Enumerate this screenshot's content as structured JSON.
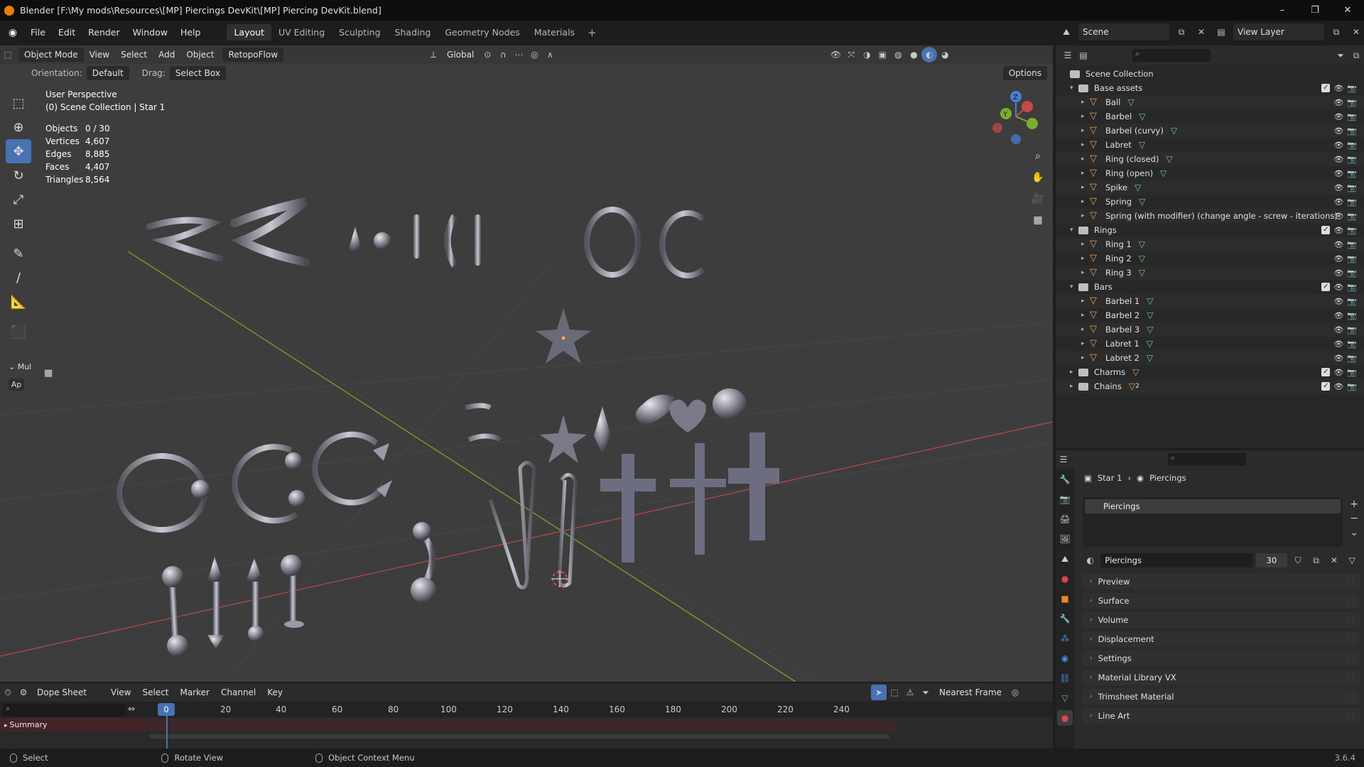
{
  "window": {
    "title": "Blender [F:\\My mods\\Resources\\[MP] Piercings DevKit\\[MP] Piercing DevKit.blend]",
    "buttons": [
      "–",
      "❐",
      "✕"
    ]
  },
  "menu": {
    "items": [
      "File",
      "Edit",
      "Render",
      "Window",
      "Help"
    ],
    "workspaces": [
      "Layout",
      "UV Editing",
      "Sculpting",
      "Shading",
      "Geometry Nodes",
      "Materials"
    ],
    "active_workspace": "Layout",
    "scene": "Scene",
    "view_layer": "View Layer"
  },
  "viewport": {
    "mode": "Object Mode",
    "menus": [
      "View",
      "Select",
      "Add",
      "Object"
    ],
    "addon": "RetopoFlow",
    "orientation_global": "Global",
    "orientation_label": "Orientation:",
    "orientation_value": "Default",
    "drag_label": "Drag:",
    "drag_value": "Select Box",
    "options": "Options",
    "info_line1": "User Perspective",
    "info_line2": "(0) Scene Collection | Star 1",
    "stats": [
      {
        "k": "Objects",
        "v": "0 / 30"
      },
      {
        "k": "Vertices",
        "v": "4,607"
      },
      {
        "k": "Edges",
        "v": "8,885"
      },
      {
        "k": "Faces",
        "v": "4,407"
      },
      {
        "k": "Triangles",
        "v": "8,564"
      }
    ],
    "panel_label": "Mul",
    "panel_btn": "Ap",
    "gizmo": {
      "x": "X",
      "y": "Y",
      "z": "Z"
    }
  },
  "timeline": {
    "editor": "Dope Sheet",
    "menus": [
      "View",
      "Select",
      "Marker",
      "Channel",
      "Key"
    ],
    "snap": "Nearest Frame",
    "current_frame": "0",
    "ticks": [
      "20",
      "40",
      "60",
      "80",
      "100",
      "120",
      "140",
      "160",
      "180",
      "200",
      "220",
      "240"
    ],
    "summary": "Summary"
  },
  "status": {
    "select": "Select",
    "rotate": "Rotate View",
    "context": "Object Context Menu",
    "version": "3.6.4"
  },
  "outliner": {
    "root": "Scene Collection",
    "rows": [
      {
        "type": "col",
        "depth": 1,
        "label": "Base assets",
        "mesh": false
      },
      {
        "type": "obj",
        "depth": 2,
        "label": "Ball",
        "mesh": true
      },
      {
        "type": "obj",
        "depth": 2,
        "label": "Barbel",
        "mesh": true
      },
      {
        "type": "obj",
        "depth": 2,
        "label": "Barbel (curvy)",
        "mesh": true
      },
      {
        "type": "obj",
        "depth": 2,
        "label": "Labret",
        "mesh": true
      },
      {
        "type": "obj",
        "depth": 2,
        "label": "Ring (closed)",
        "mesh": true
      },
      {
        "type": "obj",
        "depth": 2,
        "label": "Ring (open)",
        "mesh": true
      },
      {
        "type": "obj",
        "depth": 2,
        "label": "Spike",
        "mesh": true
      },
      {
        "type": "obj",
        "depth": 2,
        "label": "Spring",
        "mesh": true
      },
      {
        "type": "obj",
        "depth": 2,
        "label": "Spring (with modifier) (change angle - screw - iterations)",
        "mesh": false
      },
      {
        "type": "col",
        "depth": 1,
        "label": "Rings",
        "mesh": false
      },
      {
        "type": "obj",
        "depth": 2,
        "label": "Ring 1",
        "mesh": true
      },
      {
        "type": "obj",
        "depth": 2,
        "label": "Ring 2",
        "mesh": true
      },
      {
        "type": "obj",
        "depth": 2,
        "label": "Ring 3",
        "mesh": true
      },
      {
        "type": "col",
        "depth": 1,
        "label": "Bars",
        "mesh": false
      },
      {
        "type": "obj",
        "depth": 2,
        "label": "Barbel 1",
        "mesh": true
      },
      {
        "type": "obj",
        "depth": 2,
        "label": "Barbel 2",
        "mesh": true
      },
      {
        "type": "obj",
        "depth": 2,
        "label": "Barbel 3",
        "mesh": true
      },
      {
        "type": "obj",
        "depth": 2,
        "label": "Labret 1",
        "mesh": true
      },
      {
        "type": "obj",
        "depth": 2,
        "label": "Labret 2",
        "mesh": true
      },
      {
        "type": "colc",
        "depth": 1,
        "label": "Charms",
        "mesh": false
      },
      {
        "type": "colc",
        "depth": 1,
        "label": "Chains",
        "mesh": false,
        "badge": "2"
      }
    ]
  },
  "properties": {
    "breadcrumb_obj": "Star 1",
    "breadcrumb_mat": "Piercings",
    "slot": "Piercings",
    "material": "Piercings",
    "users": "30",
    "panels": [
      "Preview",
      "Surface",
      "Volume",
      "Displacement",
      "Settings",
      "Material Library VX",
      "Trimsheet Material",
      "Line Art"
    ]
  },
  "colors": {
    "accent": "#4772b3",
    "x_axis": "#c74a4a",
    "y_axis": "#7cad2e",
    "viewport_bg": "#3d3d3d"
  }
}
